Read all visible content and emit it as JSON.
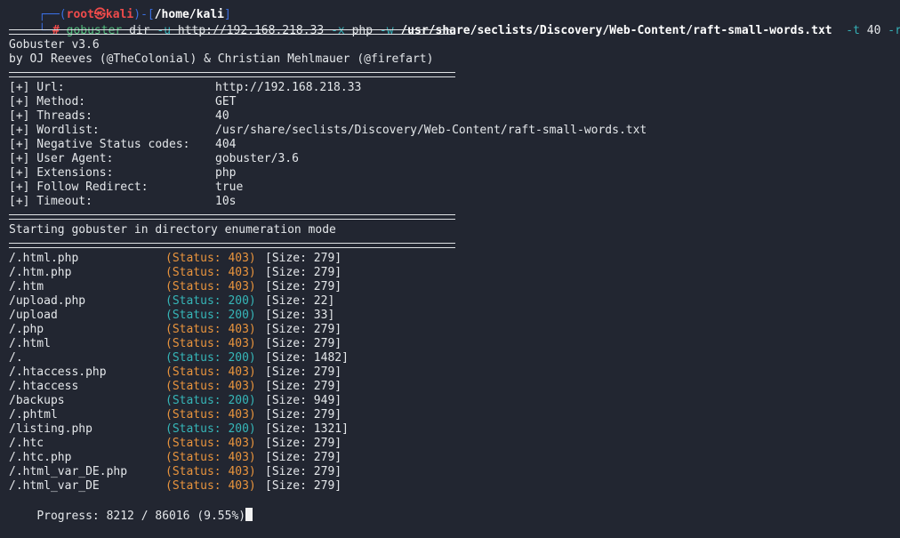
{
  "prompt": {
    "top_left": "┌──(",
    "user": "root㉿kali",
    "mid": ")-[",
    "dir": "/home/kali",
    "end": "]",
    "bottom_left": "└─",
    "symbol": "#"
  },
  "command": {
    "program": "gobuster",
    "sub": "dir",
    "flag_u": "-u",
    "url": "http://192.168.218.33",
    "flag_x": "-x",
    "ext": "php",
    "flag_w": "-w",
    "wordlist": "/usr/share/seclists/Discovery/Web-Content/raft-small-words.txt",
    "flag_t": "-t",
    "threads": "40",
    "flag_r": "-r"
  },
  "banner": {
    "version": "Gobuster v3.6",
    "authors": "by OJ Reeves (@TheColonial) & Christian Mehlmauer (@firefart)"
  },
  "config": [
    {
      "label": "[+] Url:",
      "value": "http://192.168.218.33"
    },
    {
      "label": "[+] Method:",
      "value": "GET"
    },
    {
      "label": "[+] Threads:",
      "value": "40"
    },
    {
      "label": "[+] Wordlist:",
      "value": "/usr/share/seclists/Discovery/Web-Content/raft-small-words.txt"
    },
    {
      "label": "[+] Negative Status codes:",
      "value": "404"
    },
    {
      "label": "[+] User Agent:",
      "value": "gobuster/3.6"
    },
    {
      "label": "[+] Extensions:",
      "value": "php"
    },
    {
      "label": "[+] Follow Redirect:",
      "value": "true"
    },
    {
      "label": "[+] Timeout:",
      "value": "10s"
    }
  ],
  "start_message": "Starting gobuster in directory enumeration mode",
  "results": [
    {
      "path": "/.html.php",
      "status": "(Status: 403)",
      "size": "[Size: 279]",
      "code": "403"
    },
    {
      "path": "/.htm.php",
      "status": "(Status: 403)",
      "size": "[Size: 279]",
      "code": "403"
    },
    {
      "path": "/.htm",
      "status": "(Status: 403)",
      "size": "[Size: 279]",
      "code": "403"
    },
    {
      "path": "/upload.php",
      "status": "(Status: 200)",
      "size": "[Size: 22]",
      "code": "200"
    },
    {
      "path": "/upload",
      "status": "(Status: 200)",
      "size": "[Size: 33]",
      "code": "200"
    },
    {
      "path": "/.php",
      "status": "(Status: 403)",
      "size": "[Size: 279]",
      "code": "403"
    },
    {
      "path": "/.html",
      "status": "(Status: 403)",
      "size": "[Size: 279]",
      "code": "403"
    },
    {
      "path": "/.",
      "status": "(Status: 200)",
      "size": "[Size: 1482]",
      "code": "200"
    },
    {
      "path": "/.htaccess.php",
      "status": "(Status: 403)",
      "size": "[Size: 279]",
      "code": "403"
    },
    {
      "path": "/.htaccess",
      "status": "(Status: 403)",
      "size": "[Size: 279]",
      "code": "403"
    },
    {
      "path": "/backups",
      "status": "(Status: 200)",
      "size": "[Size: 949]",
      "code": "200"
    },
    {
      "path": "/.phtml",
      "status": "(Status: 403)",
      "size": "[Size: 279]",
      "code": "403"
    },
    {
      "path": "/listing.php",
      "status": "(Status: 200)",
      "size": "[Size: 1321]",
      "code": "200"
    },
    {
      "path": "/.htc",
      "status": "(Status: 403)",
      "size": "[Size: 279]",
      "code": "403"
    },
    {
      "path": "/.htc.php",
      "status": "(Status: 403)",
      "size": "[Size: 279]",
      "code": "403"
    },
    {
      "path": "/.html_var_DE.php",
      "status": "(Status: 403)",
      "size": "[Size: 279]",
      "code": "403"
    },
    {
      "path": "/.html_var_DE",
      "status": "(Status: 403)",
      "size": "[Size: 279]",
      "code": "403"
    }
  ],
  "progress": "Progress: 8212 / 86016 (9.55%)",
  "colors": {
    "background": "#222631",
    "status_403": "#e9943d",
    "status_200": "#36b6b8",
    "prompt_blue": "#3a6ee0",
    "prompt_red": "#ef4b4b",
    "command_green": "#52bd7d"
  }
}
